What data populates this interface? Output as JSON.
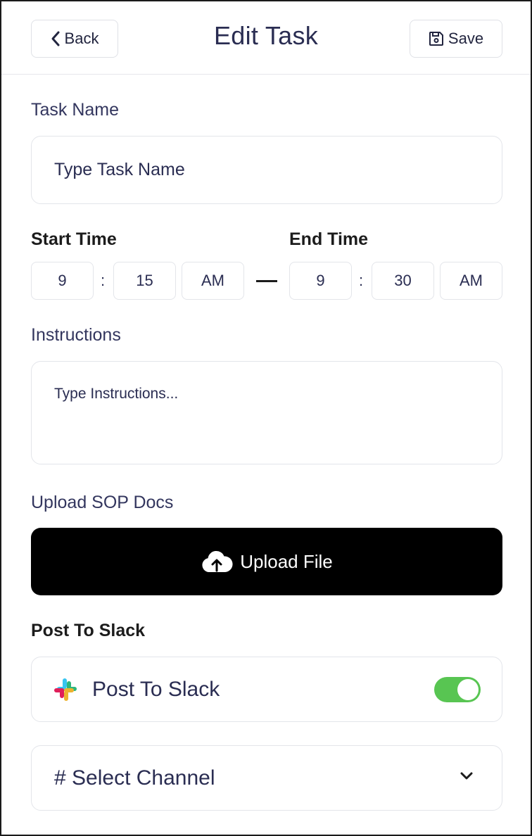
{
  "header": {
    "back_label": "Back",
    "title": "Edit Task",
    "save_label": "Save"
  },
  "task_name": {
    "label": "Task Name",
    "placeholder": "Type Task Name"
  },
  "start_time": {
    "label": "Start Time",
    "hour": "9",
    "minute": "15",
    "period": "AM"
  },
  "end_time": {
    "label": "End Time",
    "hour": "9",
    "minute": "30",
    "period": "AM"
  },
  "separator": ":",
  "instructions": {
    "label": "Instructions",
    "placeholder": "Type Instructions..."
  },
  "upload": {
    "label": "Upload SOP Docs",
    "button_label": "Upload File",
    "icon": "cloud-upload-icon"
  },
  "slack": {
    "section_label": "Post To Slack",
    "toggle_label": "Post To Slack",
    "toggle_on": true,
    "icon": "slack-icon",
    "channel_placeholder": "# Select Channel"
  },
  "colors": {
    "accent_text": "#2a2d52",
    "toggle_on": "#58c552",
    "upload_bg": "#000000"
  }
}
